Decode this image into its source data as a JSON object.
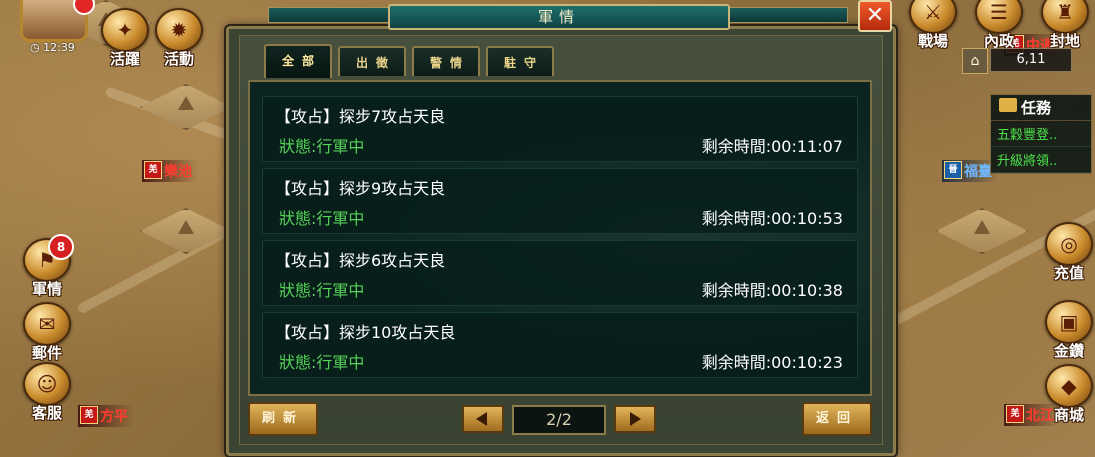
{
  "window": {
    "title": "軍情"
  },
  "hud": {
    "clock": "12:39",
    "coords": "6,11",
    "top_left_buttons": [
      {
        "label": "活躍"
      },
      {
        "label": "活動"
      }
    ],
    "top_right_buttons": [
      {
        "label": "戰場"
      },
      {
        "label": "內政"
      },
      {
        "label": "封地"
      }
    ],
    "left_buttons": [
      {
        "label": "軍情",
        "badge": "8"
      },
      {
        "label": "郵件"
      },
      {
        "label": "客服"
      }
    ],
    "right_buttons": [
      {
        "label": "充值"
      },
      {
        "label": "金鑽"
      },
      {
        "label": "商城"
      }
    ],
    "map_labels": [
      {
        "tag": "羌",
        "text": "樂池"
      },
      {
        "tag": "羌",
        "text": "方平"
      },
      {
        "tag": "羌",
        "text": "中通"
      },
      {
        "tag": "羌",
        "text": "北江"
      },
      {
        "tag": "晉",
        "text": "福臺"
      }
    ],
    "quest": {
      "title": "任務",
      "items": [
        "五穀豐登..",
        "升級將領.."
      ]
    }
  },
  "tabs": [
    {
      "label": "全部",
      "active": true
    },
    {
      "label": "出徵",
      "active": false
    },
    {
      "label": "警情",
      "active": false
    },
    {
      "label": "駐守",
      "active": false
    }
  ],
  "reports": [
    {
      "title": "【攻占】探步7攻占天良",
      "status": "狀態:行軍中",
      "remaining": "剩余時間:00:11:07"
    },
    {
      "title": "【攻占】探步9攻占天良",
      "status": "狀態:行軍中",
      "remaining": "剩余時間:00:10:53"
    },
    {
      "title": "【攻占】探步6攻占天良",
      "status": "狀態:行軍中",
      "remaining": "剩余時間:00:10:38"
    },
    {
      "title": "【攻占】探步10攻占天良",
      "status": "狀態:行軍中",
      "remaining": "剩余時間:00:10:23"
    }
  ],
  "footer": {
    "refresh_label": "刷新",
    "page": "2/2",
    "back_label": "返回"
  },
  "colors": {
    "status_green": "#57d157",
    "panel_dark": "#0c2420",
    "gold_border": "#8b7a4c",
    "map_label_red": "#ff3b2f",
    "map_label_blue": "#6fb7ff"
  }
}
